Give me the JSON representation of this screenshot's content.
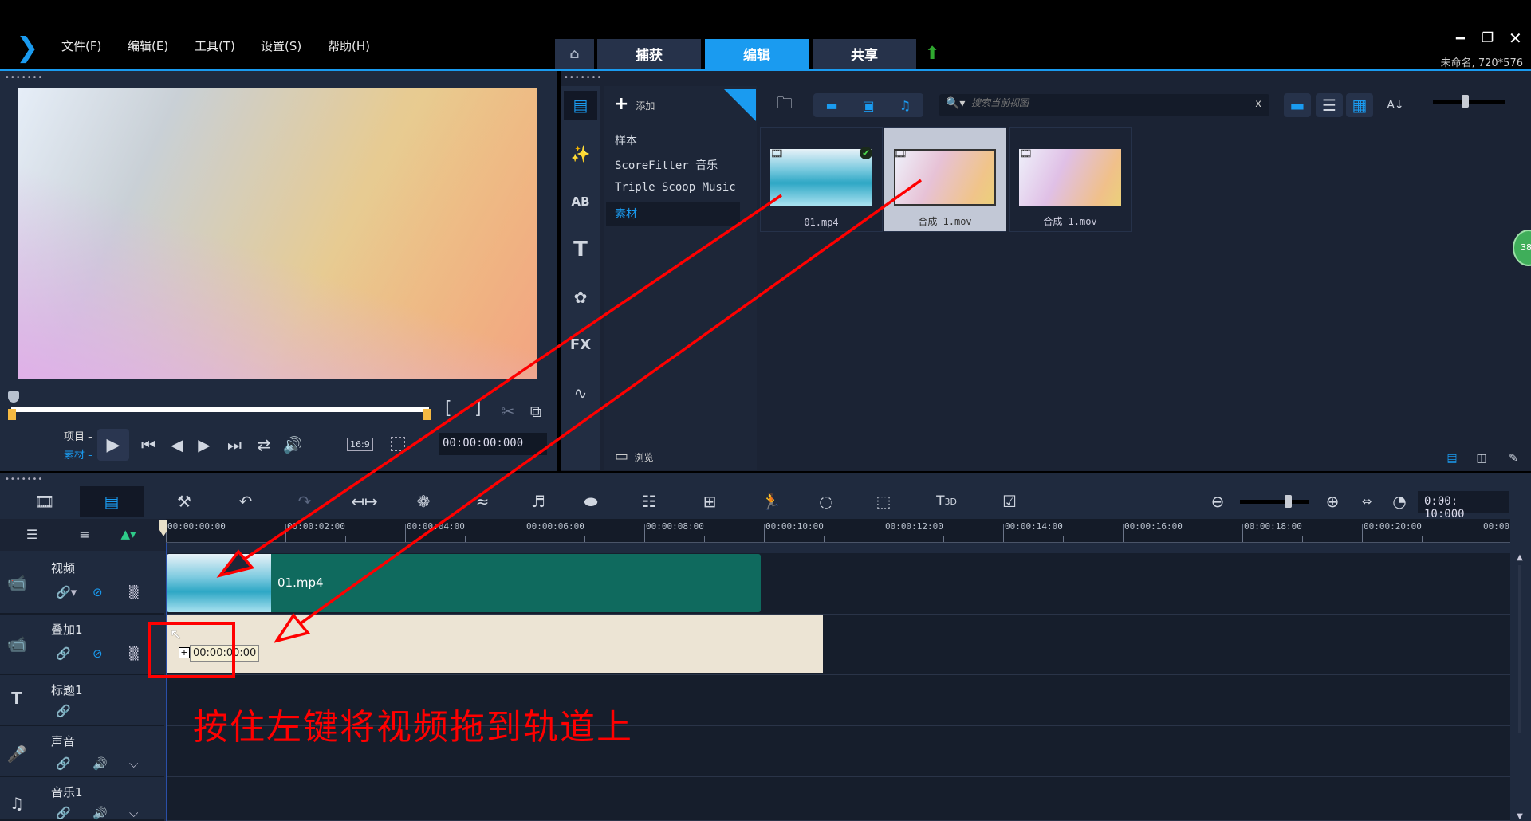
{
  "app": {
    "menu": [
      "文件(F)",
      "编辑(E)",
      "工具(T)",
      "设置(S)",
      "帮助(H)"
    ],
    "tabs": [
      {
        "label": "捕获"
      },
      {
        "label": "编辑",
        "active": true
      },
      {
        "label": "共享"
      }
    ],
    "project_info": "未命名, 720*576",
    "accent": "#1a9bf0"
  },
  "preview": {
    "mode_project": "项目",
    "mode_clip": "素材",
    "aspect": "16:9",
    "timecode": "00:00:00:000",
    "mark_in": "[",
    "mark_out": "]"
  },
  "library": {
    "add_label": "添加",
    "folders": [
      {
        "label": "样本"
      },
      {
        "label": "ScoreFitter 音乐"
      },
      {
        "label": "Triple Scoop Music"
      },
      {
        "label": "素材",
        "selected": true
      }
    ],
    "browse_label": "浏览",
    "search_placeholder": "搜索当前视图",
    "search_clear": "x",
    "items": [
      {
        "name": "01.mp4",
        "checked": true
      },
      {
        "name": "合成 1.mov",
        "selected": true
      },
      {
        "name": "合成 1.mov"
      }
    ],
    "badge": "38"
  },
  "timeline": {
    "duration": "0:00: 10:000",
    "ruler": [
      "00:00:00:00",
      "00:00:02:00",
      "00:00:04:00",
      "00:00:06:00",
      "00:00:08:00",
      "00:00:10:00",
      "00:00:12:00",
      "00:00:14:00",
      "00:00:16:00",
      "00:00:18:00",
      "00:00:20:00",
      "00:00"
    ],
    "tracks": [
      {
        "name": "视频"
      },
      {
        "name": "叠加1"
      },
      {
        "name": "标题1"
      },
      {
        "name": "声音"
      },
      {
        "name": "音乐1"
      }
    ],
    "video_clip": "01.mp4",
    "drag_tooltip": "00:00:00:00"
  },
  "annotation": {
    "text": "按住左键将视频拖到轨道上",
    "color": "#ff0000"
  }
}
